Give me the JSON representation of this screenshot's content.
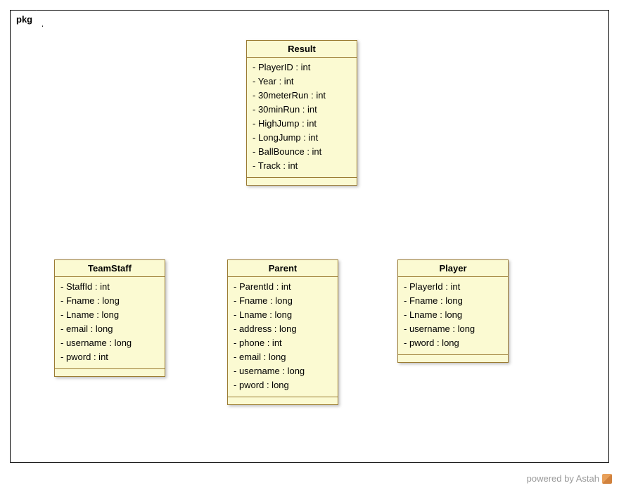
{
  "package": {
    "name": "pkg"
  },
  "footer": {
    "text": "powered by Astah"
  },
  "classes": {
    "result": {
      "name": "Result",
      "attrs": [
        "- PlayerID : int",
        "- Year : int",
        "- 30meterRun : int",
        "- 30minRun : int",
        "- HighJump : int",
        "- LongJump : int",
        "- BallBounce : int",
        "- Track : int"
      ]
    },
    "teamstaff": {
      "name": "TeamStaff",
      "attrs": [
        "- StaffId : int",
        "- Fname : long",
        "- Lname : long",
        "- email : long",
        "- username : long",
        "- pword : int"
      ]
    },
    "parent": {
      "name": "Parent",
      "attrs": [
        "- ParentId : int",
        "- Fname : long",
        "- Lname : long",
        "- address : long",
        "- phone : int",
        "- email : long",
        "- username : long",
        "- pword : long"
      ]
    },
    "player": {
      "name": "Player",
      "attrs": [
        "- PlayerId : int",
        "- Fname : long",
        "- Lname : long",
        "- username : long",
        "- pword : long"
      ]
    }
  }
}
